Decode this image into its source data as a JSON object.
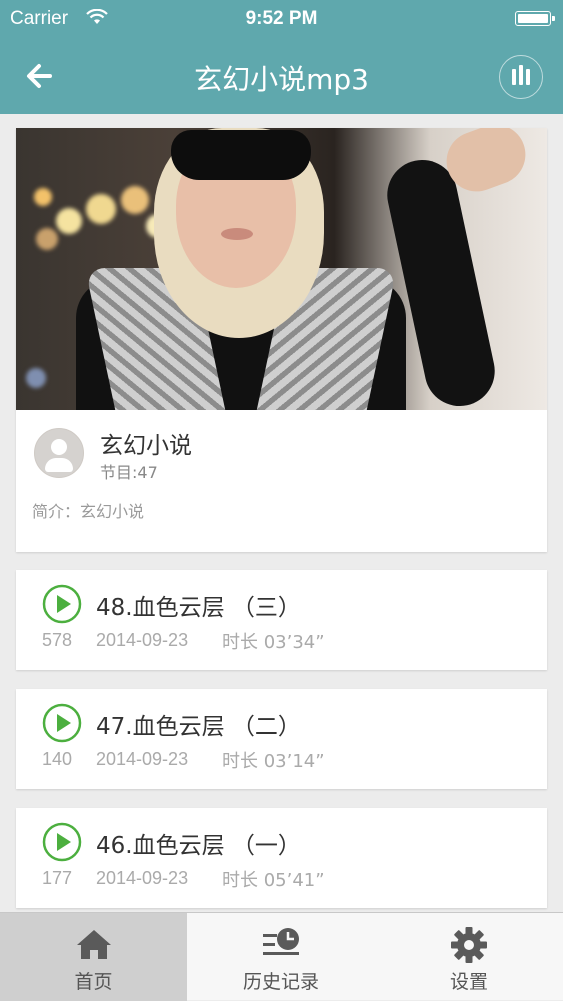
{
  "status_bar": {
    "carrier": "Carrier",
    "time": "9:52 PM"
  },
  "header": {
    "title": "玄幻小说mp3",
    "back_icon": "back-arrow-icon",
    "player_icon": "now-playing-bars-icon"
  },
  "album": {
    "name": "玄幻小说",
    "episode_count": "节目:47",
    "description": "简介：玄幻小说"
  },
  "episodes": [
    {
      "title": "48.血色云层 （三）",
      "plays": "578",
      "date": "2014-09-23",
      "duration": "时长 03’34”"
    },
    {
      "title": "47.血色云层 （二）",
      "plays": "140",
      "date": "2014-09-23",
      "duration": "时长 03’14”"
    },
    {
      "title": "46.血色云层 （一）",
      "plays": "177",
      "date": "2014-09-23",
      "duration": "时长 05’41”"
    }
  ],
  "tabs": [
    {
      "label": "首页",
      "icon": "home-icon",
      "active": true
    },
    {
      "label": "历史记录",
      "icon": "history-icon",
      "active": false
    },
    {
      "label": "设置",
      "icon": "gear-icon",
      "active": false
    }
  ],
  "colors": {
    "header": "#5fa8ad",
    "play_green": "#4caf3f",
    "tab_active_bg": "#cfcfcf"
  }
}
